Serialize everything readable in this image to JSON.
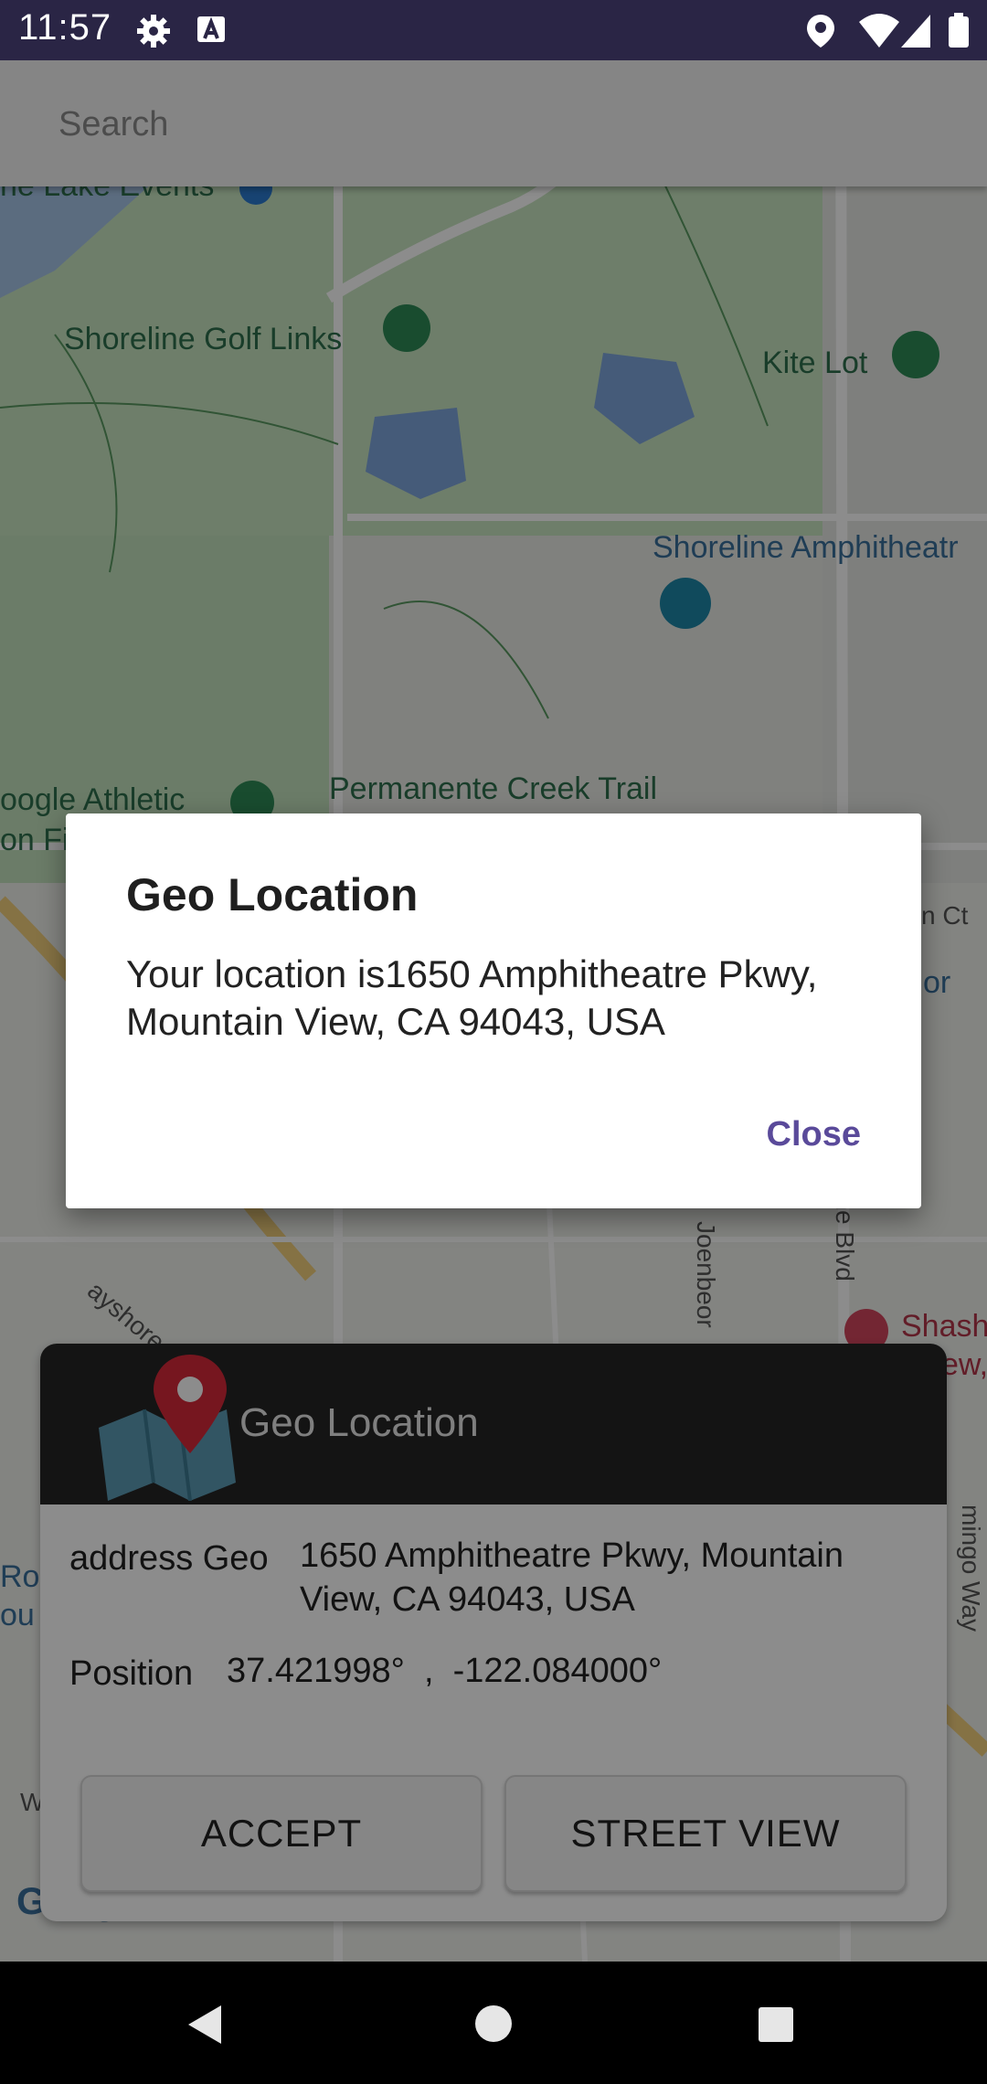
{
  "status_bar": {
    "time": "11:57",
    "icons": [
      "gear-icon",
      "a-icon",
      "location-icon",
      "wifi-icon",
      "signal-icon",
      "battery-icon"
    ]
  },
  "search": {
    "placeholder": "Search"
  },
  "map": {
    "labels": {
      "lake_events": "ne Lake Events",
      "golf": "Shoreline Golf Links",
      "kite": "Kite Lot",
      "amphitheatre": "Shoreline Amphitheatr",
      "permanente": "Permanente Creek Trail",
      "athletic_1": "oogle Athletic",
      "athletic_2": "on Fi",
      "n_ct": "n Ct",
      "or": "or",
      "bayshore": "ayshore Fwy",
      "joen": "Joenbeor",
      "shoreline_blvd": "line Blvd",
      "shash_1": "Shash",
      "shash_2": "ew,",
      "roc_1": "Roc",
      "roc_2": "ou",
      "amingo": "mingo Way",
      "w": "W"
    },
    "google": "Google",
    "colors": {
      "water": "#aac8e6",
      "park": "#c9e6c2",
      "road": "#ffffff",
      "highway": "#f5d38a"
    }
  },
  "card": {
    "title": "Geo Location",
    "address_label": "address Geo",
    "address_value_line1": "1650 Amphitheatre Pkwy, Mountain",
    "address_value_line2": "View, CA 94043, USA",
    "position_label": "Position",
    "position_value": "37.421998°  ,  -122.084000°",
    "accept_label": "ACCEPT",
    "street_view_label": "STREET VIEW"
  },
  "dialog": {
    "title": "Geo Location",
    "message": "Your location is1650 Amphitheatre Pkwy, Mountain View, CA 94043, USA",
    "close_label": "Close"
  },
  "nav": {
    "buttons": [
      "back-icon",
      "home-icon",
      "recents-icon"
    ]
  }
}
